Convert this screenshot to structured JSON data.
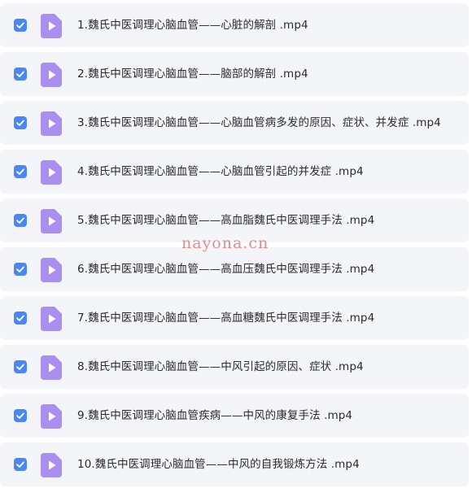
{
  "colors": {
    "row_background": "#f4f5f9",
    "checkbox_checked": "#4a86f7",
    "video_icon": "#a98ff0",
    "text": "#2b2b2b",
    "watermark": "#e88b8b"
  },
  "files": [
    {
      "name": "1.魏氏中医调理心脑血管——心脏的解剖 .mp4",
      "checked": true,
      "icon": "video-file-icon"
    },
    {
      "name": "2.魏氏中医调理心脑血管——脑部的解剖 .mp4",
      "checked": true,
      "icon": "video-file-icon"
    },
    {
      "name": "3.魏氏中医调理心脑血管——心脑血管病多发的原因、症状、并发症 .mp4",
      "checked": true,
      "icon": "video-file-icon"
    },
    {
      "name": "4.魏氏中医调理心脑血管——心脑血管引起的并发症 .mp4",
      "checked": true,
      "icon": "video-file-icon"
    },
    {
      "name": "5.魏氏中医调理心脑血管——高血脂魏氏中医调理手法 .mp4",
      "checked": true,
      "icon": "video-file-icon"
    },
    {
      "name": "6.魏氏中医调理心脑血管——高血压魏氏中医调理手法 .mp4",
      "checked": true,
      "icon": "video-file-icon"
    },
    {
      "name": "7.魏氏中医调理心脑血管——高血糖魏氏中医调理手法 .mp4",
      "checked": true,
      "icon": "video-file-icon"
    },
    {
      "name": "8.魏氏中医调理心脑血管——中风引起的原因、症状 .mp4",
      "checked": true,
      "icon": "video-file-icon"
    },
    {
      "name": "9.魏氏中医调理心脑血管疾病——中风的康复手法 .mp4",
      "checked": true,
      "icon": "video-file-icon"
    },
    {
      "name": "10.魏氏中医调理心脑血管——中风的自我锻炼方法 .mp4",
      "checked": true,
      "icon": "video-file-icon"
    }
  ],
  "watermark": "nayona.cn"
}
